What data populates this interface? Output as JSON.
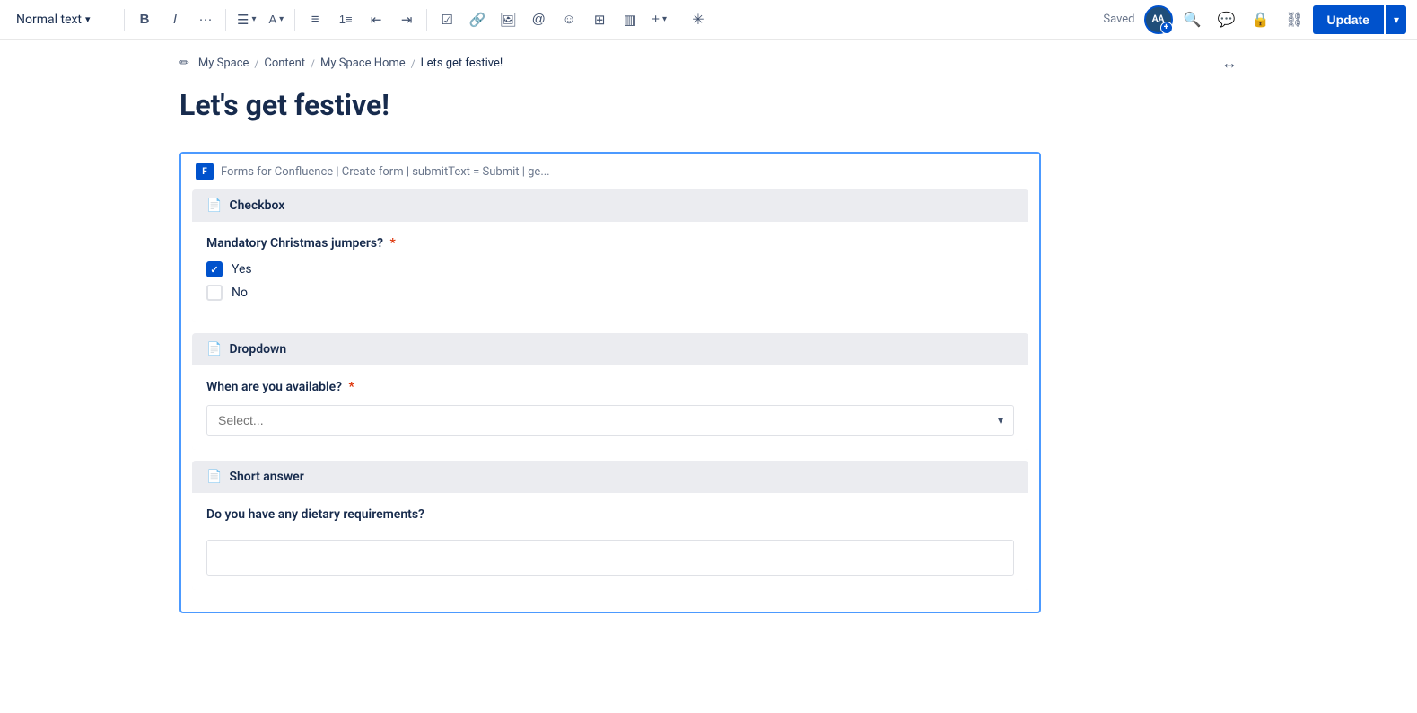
{
  "toolbar": {
    "text_style_label": "Normal text",
    "bold_label": "B",
    "italic_label": "I",
    "more_label": "···",
    "saved_label": "Saved",
    "avatar_initials": "AA",
    "update_label": "Update",
    "chevron_down": "▾"
  },
  "breadcrumb": {
    "pencil_icon": "✏",
    "items": [
      {
        "label": "My Space",
        "sep": "/"
      },
      {
        "label": "Content",
        "sep": "/"
      },
      {
        "label": "My Space Home",
        "sep": "/"
      },
      {
        "label": "Lets get festive!",
        "sep": ""
      }
    ],
    "expand_icon": "↔"
  },
  "page": {
    "title": "Let's get festive!"
  },
  "form": {
    "plugin_label": "F",
    "header_text": "Forms for Confluence | Create form | submitText = Submit | ge...",
    "sections": [
      {
        "id": "checkbox",
        "icon": "📄",
        "header": "Checkbox",
        "field_label": "Mandatory Christmas jumpers?",
        "required": true,
        "options": [
          {
            "label": "Yes",
            "checked": true
          },
          {
            "label": "No",
            "checked": false
          }
        ]
      },
      {
        "id": "dropdown",
        "icon": "📄",
        "header": "Dropdown",
        "field_label": "When are you available?",
        "required": true,
        "placeholder": "Select..."
      },
      {
        "id": "short-answer",
        "icon": "📄",
        "header": "Short answer",
        "field_label": "Do you have any dietary requirements?",
        "required": false,
        "placeholder": ""
      }
    ]
  }
}
